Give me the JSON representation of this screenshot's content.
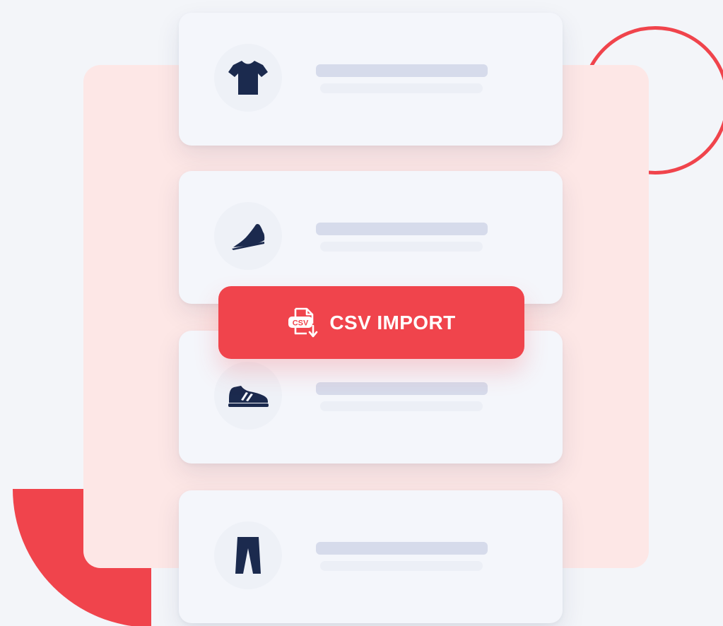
{
  "import_button": {
    "label": "CSV IMPORT",
    "icon": "csv-file-download-icon",
    "icon_text": "CSV"
  },
  "products": [
    {
      "icon": "tshirt-icon"
    },
    {
      "icon": "dress-shoe-icon"
    },
    {
      "icon": "sneaker-icon"
    },
    {
      "icon": "trousers-icon"
    }
  ],
  "colors": {
    "accent": "#f0444c",
    "icon": "#1b2a4e",
    "card": "#f4f6fb",
    "placeholder_line": "#d6dbeb",
    "background": "#f3f5f9",
    "panel": "#fde7e6"
  }
}
